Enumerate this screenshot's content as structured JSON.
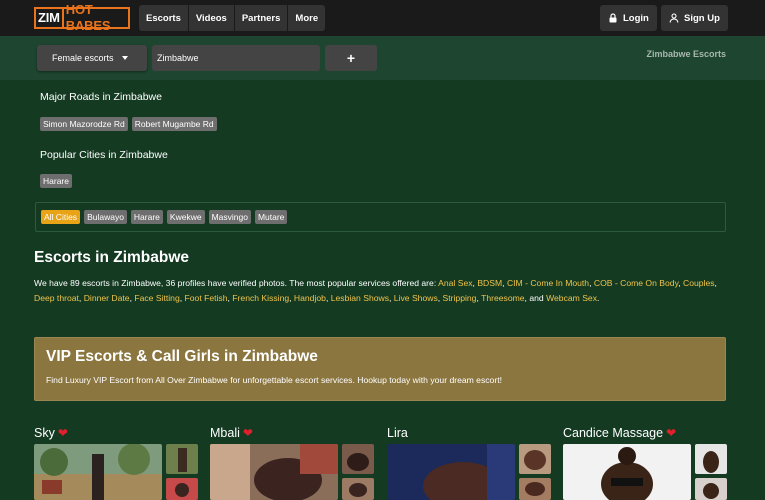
{
  "brand": {
    "logo_part1": "ZIM",
    "logo_part2": "HOT BABES"
  },
  "nav": {
    "items": [
      "Escorts",
      "Videos",
      "Partners",
      "More"
    ]
  },
  "auth": {
    "login": "Login",
    "signup": "Sign Up"
  },
  "search": {
    "category": "Female escorts",
    "location": "Zimbabwe",
    "add_label": "+"
  },
  "breadcrumb": "Zimbabwe Escorts",
  "roads": {
    "title": "Major Roads in Zimbabwe",
    "items": [
      "Simon Mazorodze Rd",
      "Robert Mugambe Rd"
    ]
  },
  "cities": {
    "title": "Popular Cities in Zimbabwe",
    "items": [
      "Harare"
    ]
  },
  "city_filter": {
    "items": [
      "All Cities",
      "Bulawayo",
      "Harare",
      "Kwekwe",
      "Masvingo",
      "Mutare"
    ],
    "active": "All Cities"
  },
  "page_title": "Escorts in Zimbabwe",
  "intro": {
    "lead": "We have 89 escorts in Zimbabwe, 36 profiles have verified photos. The most popular services offered are: ",
    "services": [
      "Anal Sex",
      "BDSM",
      "CIM - Come In Mouth",
      "COB - Come On Body",
      "Couples",
      "Deep throat",
      "Dinner Date",
      "Face Sitting",
      "Foot Fetish",
      "French Kissing",
      "Handjob",
      "Lesbian Shows",
      "Live Shows",
      "Stripping",
      "Threesome",
      "Webcam Sex"
    ],
    "and": "and",
    "end": "."
  },
  "vip": {
    "title": "VIP Escorts & Call Girls in Zimbabwe",
    "desc": "Find Luxury VIP Escort from All Over Zimbabwe for unforgettable escort services. Hookup today with your dream escort!"
  },
  "profiles": [
    {
      "name": "Sky",
      "favorite": true
    },
    {
      "name": "Mbali",
      "favorite": true
    },
    {
      "name": "Lira",
      "favorite": false
    },
    {
      "name": "Candice Massage",
      "favorite": true
    }
  ],
  "colors": {
    "accent": "#e9741d",
    "services": "#f0c44a",
    "vip_bg": "#8b7640",
    "page_bg": "#143a22",
    "active_tag": "#e8a317"
  }
}
